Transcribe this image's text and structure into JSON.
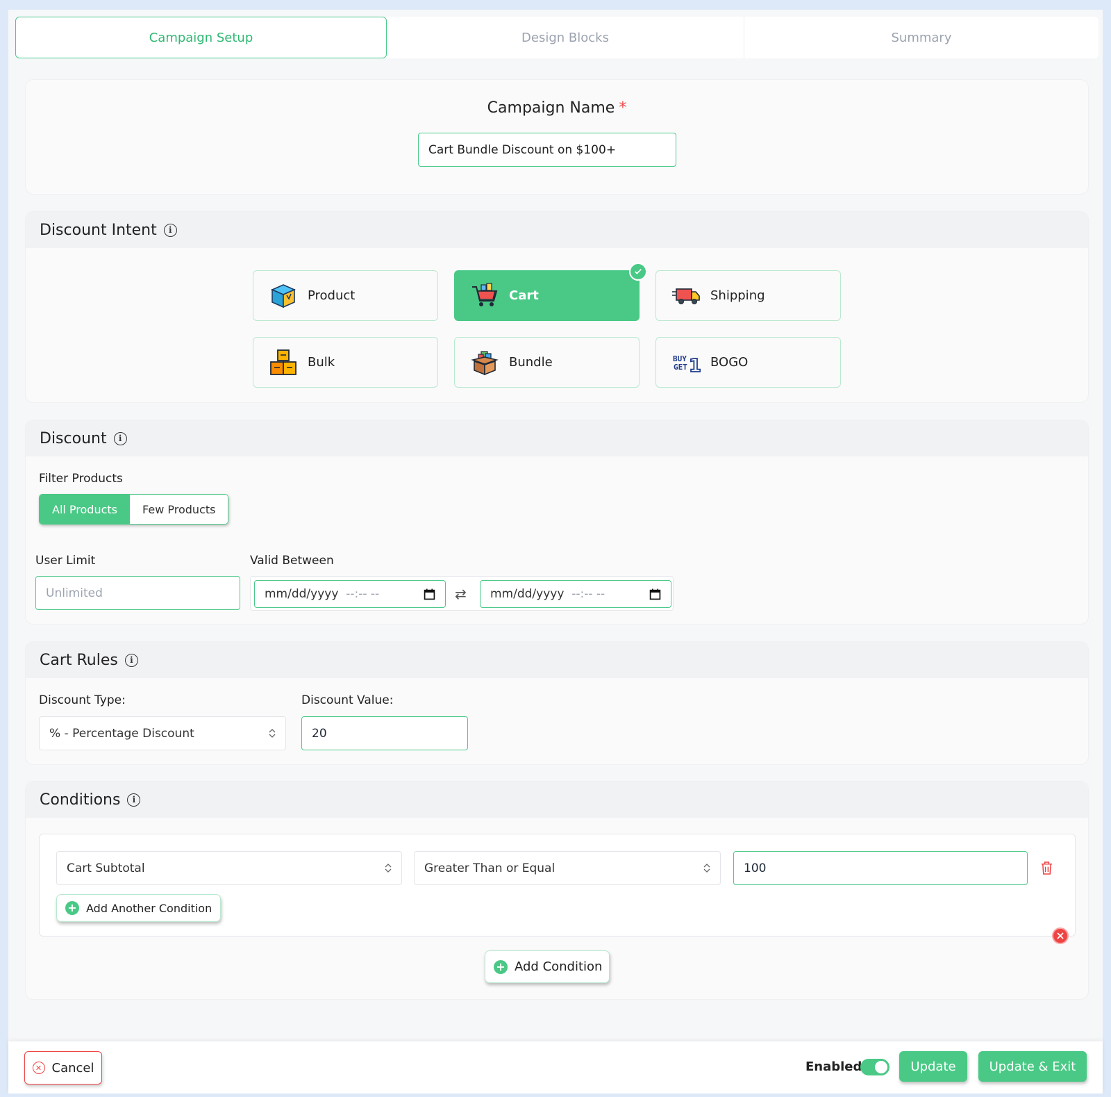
{
  "tabs": [
    {
      "label": "Campaign Setup",
      "active": true
    },
    {
      "label": "Design Blocks",
      "active": false
    },
    {
      "label": "Summary",
      "active": false
    }
  ],
  "campaign": {
    "label": "Campaign Name",
    "required_mark": "*",
    "value": "Cart Bundle Discount on $100+"
  },
  "intent": {
    "title": "Discount Intent",
    "options": [
      {
        "label": "Product",
        "icon": "box-icon",
        "selected": false
      },
      {
        "label": "Cart",
        "icon": "cart-icon",
        "selected": true
      },
      {
        "label": "Shipping",
        "icon": "truck-icon",
        "selected": false
      },
      {
        "label": "Bulk",
        "icon": "stacked-boxes-icon",
        "selected": false
      },
      {
        "label": "Bundle",
        "icon": "open-box-icon",
        "selected": false
      },
      {
        "label": "BOGO",
        "icon": "buy1-get1-icon",
        "selected": false
      }
    ]
  },
  "discount": {
    "title": "Discount",
    "filter_label": "Filter Products",
    "filter_options": [
      "All Products",
      "Few Products"
    ],
    "filter_selected": "All Products",
    "user_limit_label": "User Limit",
    "user_limit_placeholder": "Unlimited",
    "valid_between_label": "Valid Between",
    "date_format": "mm/dd/yyyy",
    "time_format": "--:-- --"
  },
  "cart_rules": {
    "title": "Cart Rules",
    "type_label": "Discount Type:",
    "type_value": "% - Percentage Discount",
    "value_label": "Discount Value:",
    "value": "20"
  },
  "conditions": {
    "title": "Conditions",
    "rows": [
      {
        "field": "Cart Subtotal",
        "operator": "Greater Than or Equal",
        "value": "100"
      }
    ],
    "add_another_label": "Add Another Condition",
    "add_condition_label": "Add Condition"
  },
  "footer": {
    "cancel_label": "Cancel",
    "enabled_label": "Enabled",
    "enabled": true,
    "update_label": "Update",
    "update_exit_label": "Update & Exit"
  },
  "colors": {
    "accent": "#49c985",
    "danger": "#ef4444"
  }
}
